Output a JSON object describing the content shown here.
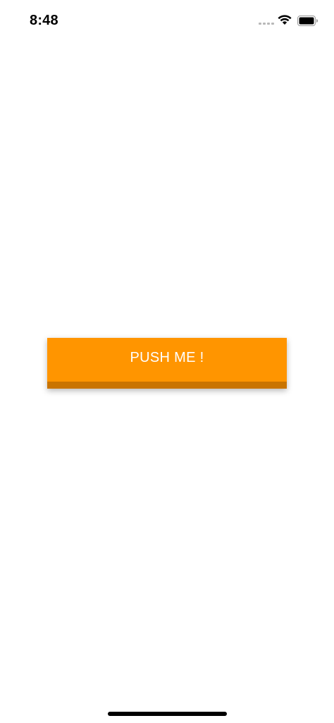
{
  "status_bar": {
    "time": "8:48",
    "icons": [
      "signal-icon",
      "wifi-icon",
      "battery-icon"
    ]
  },
  "main": {
    "button_label": "PUSH ME !"
  },
  "colors": {
    "accent": "#ff9500",
    "accent_dark": "#c97400",
    "background": "#ffffff"
  }
}
